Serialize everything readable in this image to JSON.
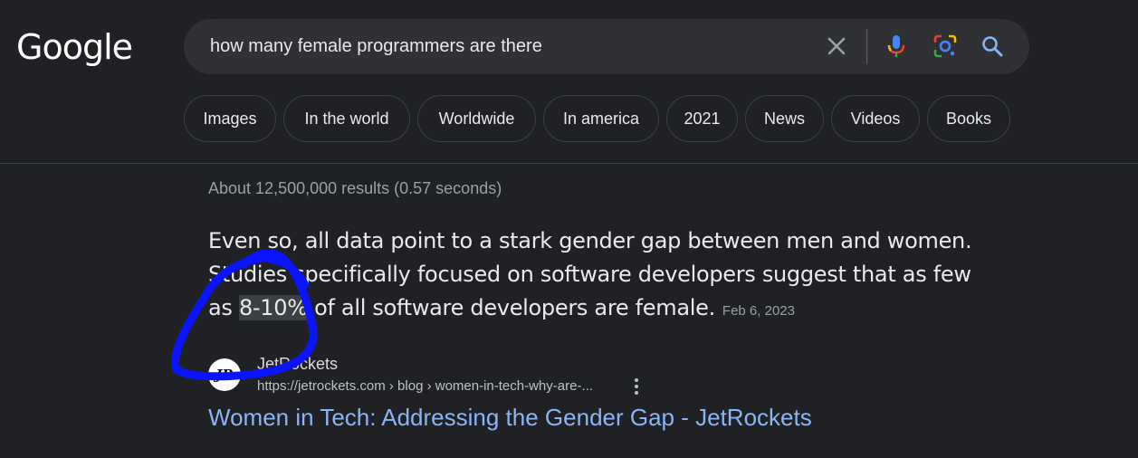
{
  "logo": {
    "text": "Google"
  },
  "search": {
    "query": "how many female programmers are there"
  },
  "chips": [
    "Images",
    "In the world",
    "Worldwide",
    "In america",
    "2021",
    "News",
    "Videos",
    "Books"
  ],
  "results": {
    "stats": "About 12,500,000 results (0.57 seconds)",
    "snippet": {
      "line1": "Even so, all data point to a stark gender gap between men and women.",
      "line2": "Studies specifically focused on software developers suggest that as few",
      "line3_pre": "as ",
      "highlight": "8-10%",
      "line3_post": " of all software developers are female.",
      "date": "Feb 6, 2023"
    },
    "source": {
      "favicon_text": "JR",
      "site_name": "JetRockets",
      "url": "https://jetrockets.com › blog › women-in-tech-why-are-..."
    },
    "title": "Women in Tech: Addressing the Gender Gap - JetRockets"
  },
  "icons": [
    "clear-icon",
    "mic-icon",
    "lens-icon",
    "search-icon",
    "more-vert-icon"
  ],
  "colors": {
    "background": "#202124",
    "search_bg": "#303134",
    "link": "#8ab4f8",
    "annotation": "#0a14ff"
  }
}
